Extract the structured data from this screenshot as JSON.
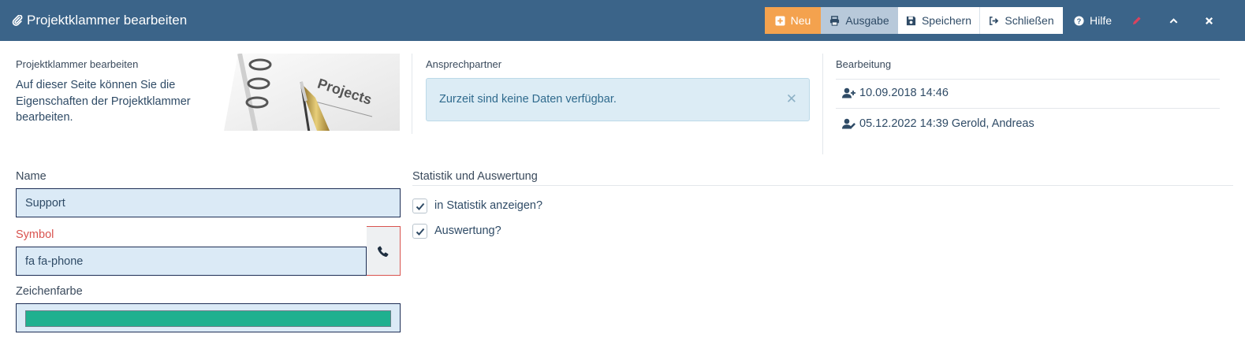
{
  "window": {
    "title": "Projektklammer bearbeiten",
    "icon": "paperclip-icon"
  },
  "toolbar": {
    "neu": "Neu",
    "ausgabe": "Ausgabe",
    "speichern": "Speichern",
    "schliessen": "Schließen",
    "hilfe": "Hilfe",
    "colors": {
      "bar": "#3b6489",
      "neu": "#f4a24e",
      "ausgabe": "#b8c9da"
    }
  },
  "intro": {
    "heading": "Projektklammer bearbeiten",
    "text": "Auf dieser Seite können Sie die Eigenschaften der Projektklammer bearbeiten.",
    "image_caption": "Projects"
  },
  "contacts": {
    "heading": "Ansprechpartner",
    "empty_message": "Zurzeit sind keine Daten verfügbar."
  },
  "history": {
    "heading": "Bearbeitung",
    "created": "10.09.2018 14:46",
    "modified": "05.12.2022 14:39 Gerold, Andreas"
  },
  "form": {
    "name_label": "Name",
    "name_value": "Support",
    "symbol_label": "Symbol",
    "symbol_value": "fa fa-phone",
    "symbol_icon": "phone-icon",
    "color_label": "Zeichenfarbe",
    "color_value": "#1fb08f"
  },
  "stats": {
    "heading": "Statistik und Auswertung",
    "show_in_stats_label": "in Statistik anzeigen?",
    "show_in_stats_checked": true,
    "evaluation_label": "Auswertung?",
    "evaluation_checked": true
  }
}
